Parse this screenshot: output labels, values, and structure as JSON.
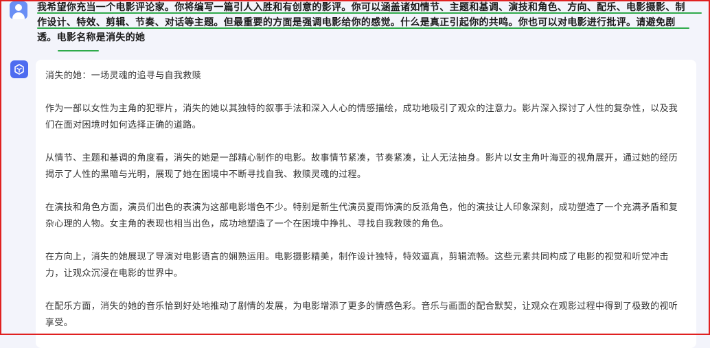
{
  "user_message": {
    "avatar_icon": "user-avatar-icon",
    "text": "我希望你充当一个电影评论家。你将编写一篇引人入胜和有创意的影评。你可以涵盖诸如情节、主题和基调、演技和角色、方向、配乐、电影摄影、制作设计、特效、剪辑、节奏、对话等主题。但最重要的方面是强调电影给你的感觉。什么是真正引起你的共鸣。你也可以对电影进行批评。请避免剧透。电影名称是消失的她"
  },
  "assistant_message": {
    "avatar_icon": "assistant-cube-icon",
    "paragraphs": [
      "消失的她：一场灵魂的追寻与自我救赎",
      "作为一部以女性为主角的犯罪片，消失的她以其独特的叙事手法和深入人心的情感描绘，成功地吸引了观众的注意力。影片深入探讨了人性的复杂性，以及我们在面对困境时如何选择正确的道路。",
      "从情节、主题和基调的角度看，消失的她是一部精心制作的电影。故事情节紧凑，节奏紧凑，让人无法抽身。影片以女主角叶海亚的视角展开，通过她的经历揭示了人性的黑暗与光明，展现了她在困境中不断寻找自我、救赎灵魂的过程。",
      "在演技和角色方面，演员们出色的表演为这部电影增色不少。特别是新生代演员夏雨饰演的反派角色，他的演技让人印象深刻，成功塑造了一个充满矛盾和复杂心理的人物。女主角的表现也相当出色，成功地塑造了一个在困境中挣扎、寻找自我救赎的角色。",
      "在方向上，消失的她展现了导演对电影语言的娴熟运用。电影摄影精美，制作设计独特，特效逼真，剪辑流畅。这些元素共同构成了电影的视觉和听觉冲击力，让观众沉浸在电影的世界中。",
      "在配乐方面，消失的她的音乐恰到好处地推动了剧情的发展，为电影增添了更多的情感色彩。音乐与画面的配合默契，让观众在观影过程中得到了极致的视听享受。"
    ]
  },
  "colors": {
    "frame_border": "#e02020",
    "highlight_underline": "#2eaa4a",
    "user_avatar": "#6a8ff5",
    "assistant_avatar": "#4e6cf0",
    "page_background": "#f3f4fb",
    "card_background": "#ffffff"
  }
}
